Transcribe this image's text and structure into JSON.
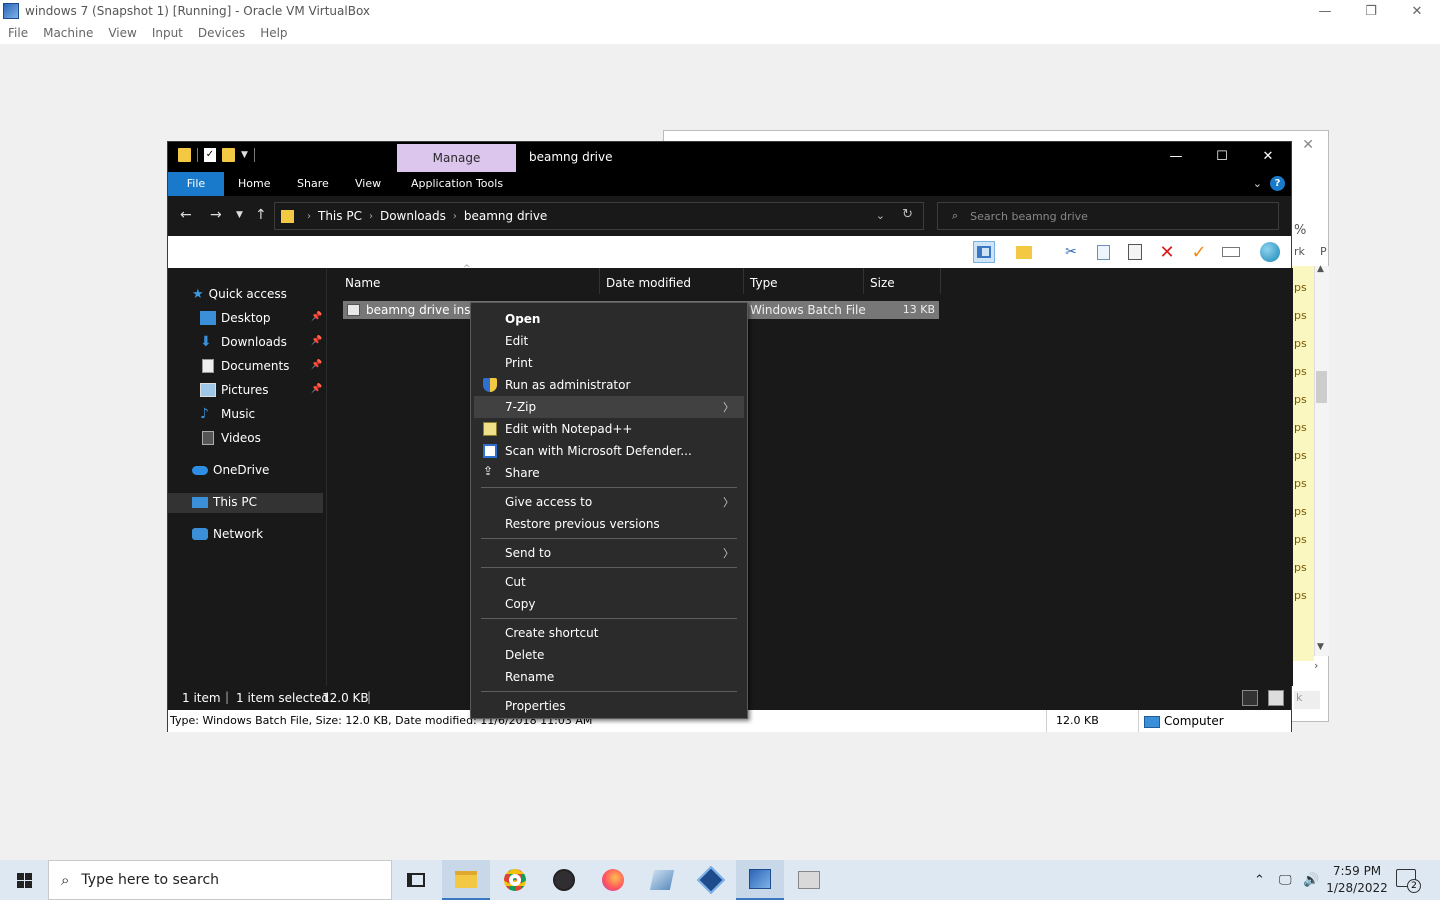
{
  "vbox": {
    "title": "windows 7 (Snapshot 1) [Running] - Oracle VM VirtualBox",
    "menu": [
      "File",
      "Machine",
      "View",
      "Input",
      "Devices",
      "Help"
    ],
    "controls": {
      "minimize": "—",
      "restore": "❐",
      "close": "✕"
    }
  },
  "background_window": {
    "strip_label_1": "%",
    "strip_label_2": "rk",
    "strip_label_3": "P",
    "ps_items": [
      "ps",
      "ps",
      "ps",
      "ps",
      "ps",
      "ps",
      "ps",
      "ps",
      "ps",
      "ps",
      "ps",
      "ps"
    ],
    "bottom_label": "k",
    "close": "✕"
  },
  "explorer": {
    "manage_tab": "Manage",
    "title": "beamng drive",
    "controls": {
      "minimize": "—",
      "maximize": "☐",
      "close": "✕"
    },
    "ribbon_tabs": {
      "file": "File",
      "home": "Home",
      "share": "Share",
      "view": "View",
      "app_tools": "Application Tools"
    },
    "help": "?",
    "address": {
      "this_pc": "This PC",
      "downloads": "Downloads",
      "folder": "beamng drive"
    },
    "search_placeholder": "Search beamng drive",
    "nav": {
      "quick_access": "Quick access",
      "desktop": "Desktop",
      "downloads": "Downloads",
      "documents": "Documents",
      "pictures": "Pictures",
      "music": "Music",
      "videos": "Videos",
      "onedrive": "OneDrive",
      "this_pc": "This PC",
      "network": "Network"
    },
    "columns": {
      "name": "Name",
      "date": "Date modified",
      "type": "Type",
      "size": "Size"
    },
    "file": {
      "name": "beamng drive install",
      "type": "Windows Batch File",
      "size": "13 KB"
    },
    "status": {
      "items": "1 item",
      "selected": "1 item selected",
      "selected_size": "12.0 KB"
    },
    "details": {
      "text": "Type: Windows Batch File, Size: 12.0 KB, Date modified: 11/6/2018 11:03 AM",
      "size": "12.0 KB",
      "location": "Computer"
    }
  },
  "context_menu": {
    "open": "Open",
    "edit": "Edit",
    "print": "Print",
    "run_admin": "Run as administrator",
    "zip": "7-Zip",
    "notepadpp": "Edit with Notepad++",
    "defender": "Scan with Microsoft Defender...",
    "share": "Share",
    "give_access": "Give access to",
    "restore": "Restore previous versions",
    "send_to": "Send to",
    "cut": "Cut",
    "copy": "Copy",
    "create_shortcut": "Create shortcut",
    "delete": "Delete",
    "rename": "Rename",
    "properties": "Properties"
  },
  "taskbar": {
    "search_placeholder": "Type here to search",
    "time": "7:59 PM",
    "date": "1/28/2022",
    "notifications": "2"
  }
}
